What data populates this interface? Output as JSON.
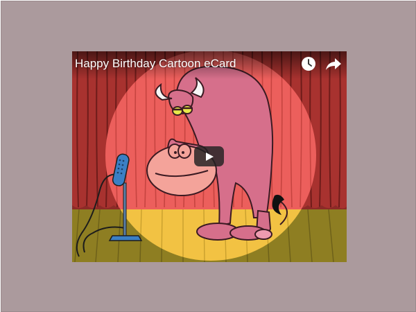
{
  "video": {
    "title": "Happy Birthday Cartoon eCard",
    "icons": {
      "watch_later": "clock-icon",
      "share": "share-arrow-icon",
      "play": "play-icon"
    }
  },
  "colors": {
    "page_background": "#ab9a9d",
    "curtain": "#b53a36",
    "spotlight": "#ec5f5c",
    "stage_floor": "#b3a033",
    "spotlight_floor": "#f4c542",
    "character_body": "#d66f8b",
    "microphone": "#3b7fc4"
  }
}
